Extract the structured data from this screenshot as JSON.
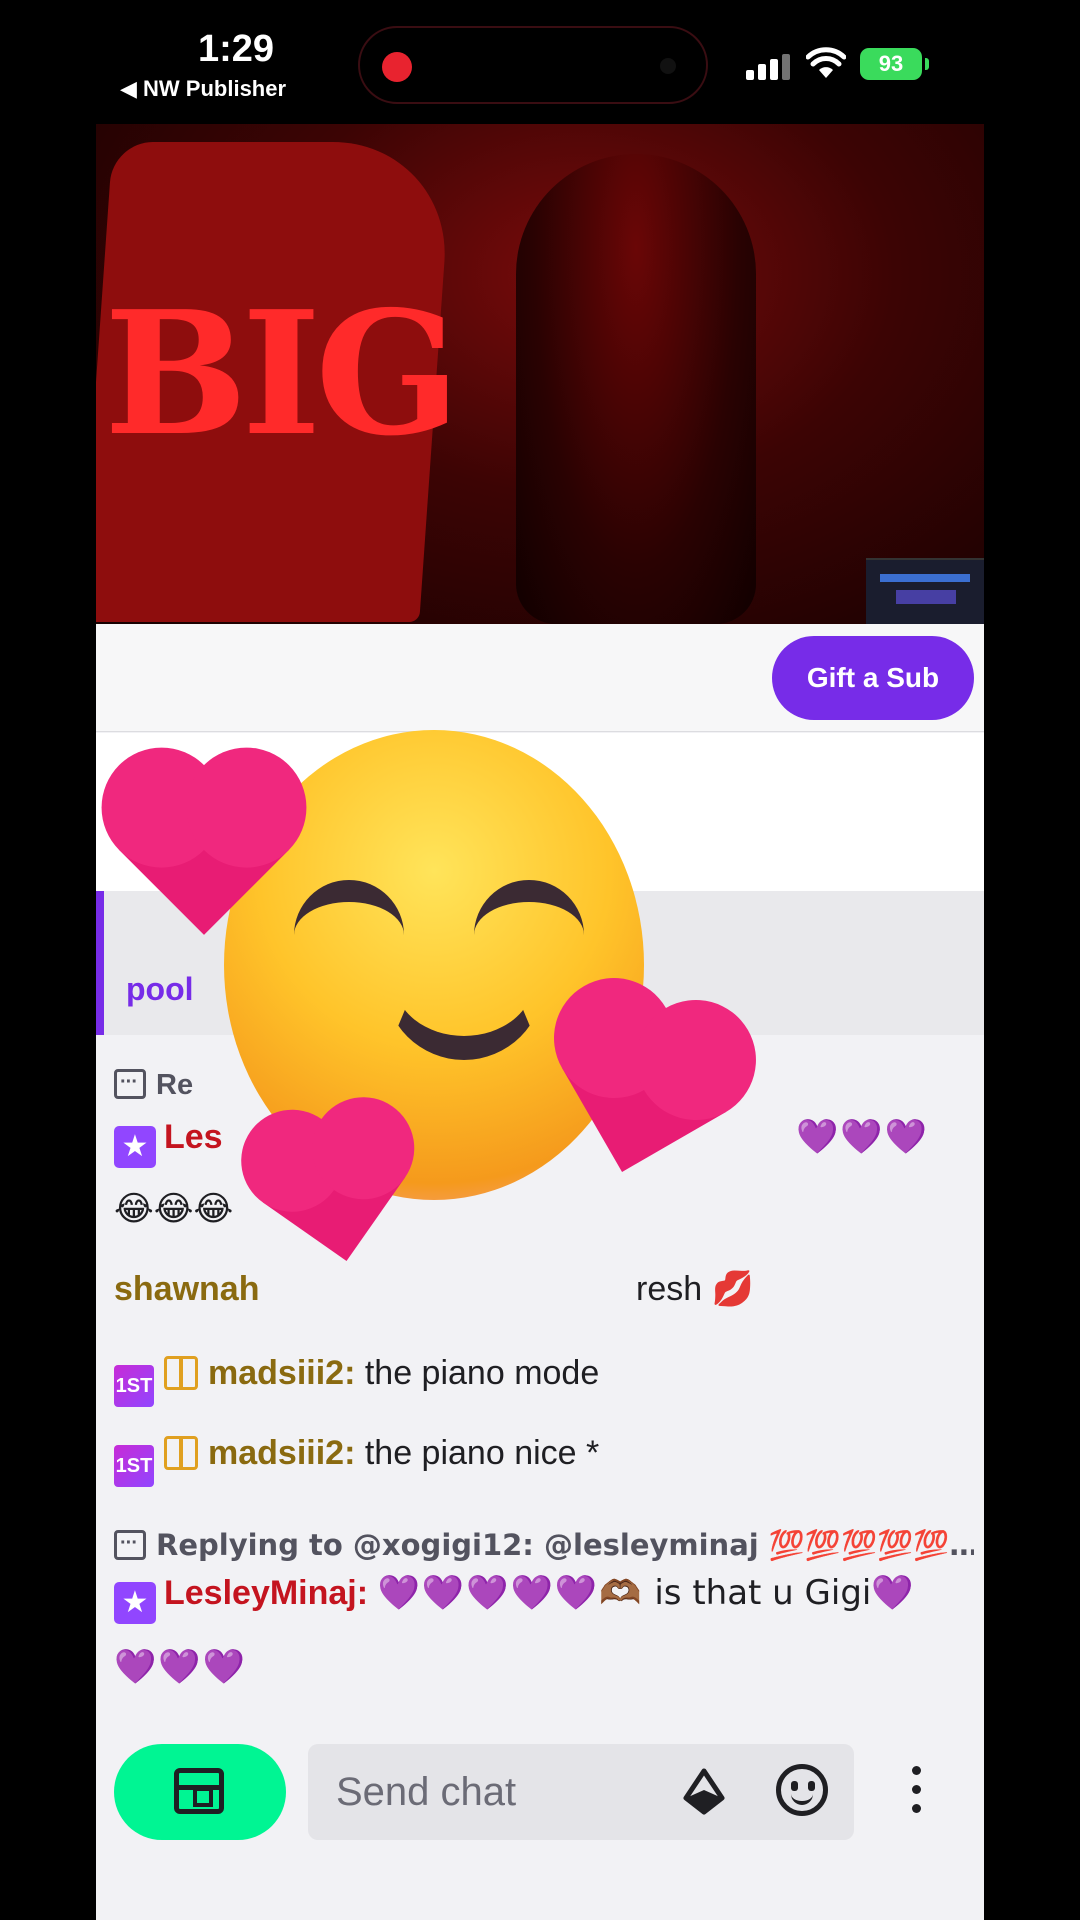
{
  "status_bar": {
    "time": "1:29",
    "back_app": "◀ NW Publisher",
    "battery": "93"
  },
  "video": {
    "shirt_text": "BIG"
  },
  "sub_bar": {
    "gift_label": "Gift a Sub"
  },
  "highlight": {
    "username_partial": "pool"
  },
  "chat": {
    "messages": [
      {
        "reply_text": "Re",
        "user": "Les",
        "text_visible": "💜💜💜",
        "line2": "😂😂😂"
      },
      {
        "user": "shawnah",
        "text_visible": "resh 💋"
      },
      {
        "user": "madsiii2:",
        "text": "the piano mode",
        "badge_first": "1ST"
      },
      {
        "user": "madsiii2:",
        "text": "the piano nice *",
        "badge_first": "1ST"
      },
      {
        "reply_text": "Replying to @xogigi12: @lesleyminaj 💯💯💯💯💯…",
        "user": "LesleyMinaj:",
        "hearts": "💜💜💜💜💜🫶🏾",
        "text": " is that u Gigi💜",
        "line2": "💜💜💜"
      }
    ]
  },
  "input": {
    "placeholder": "Send chat"
  },
  "colors": {
    "accent": "#772ce8",
    "chest_button": "#00f593",
    "username_red": "#c4141f",
    "username_gold": "#8a6a10"
  },
  "icons": [
    "back-arrow-icon",
    "signal-icon",
    "wifi-icon",
    "battery-icon",
    "reply-icon",
    "vip-star-badge-icon",
    "first-badge-icon",
    "gift-badge-icon",
    "treasure-chest-icon",
    "bits-icon",
    "emote-icon",
    "more-icon"
  ]
}
